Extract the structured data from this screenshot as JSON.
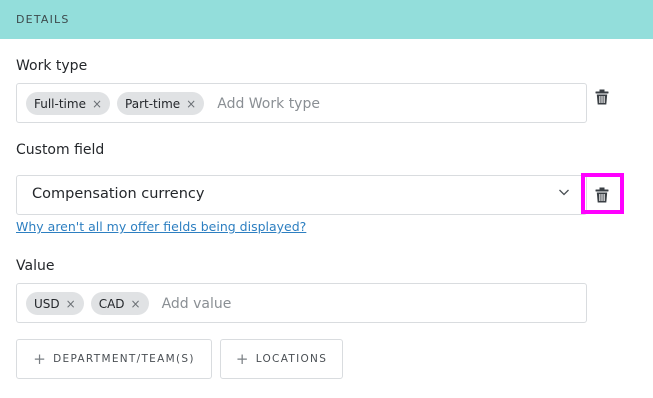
{
  "header": {
    "title": "DETAILS"
  },
  "work_type": {
    "label": "Work type",
    "tags": [
      {
        "text": "Full-time",
        "remove": "×"
      },
      {
        "text": "Part-time",
        "remove": "×"
      }
    ],
    "placeholder": "Add Work type",
    "delete_icon": "trash-icon"
  },
  "custom_field": {
    "label": "Custom field",
    "selected": "Compensation currency",
    "dropdown_icon": "chevron-down-icon",
    "delete_icon": "trash-icon",
    "highlight_color": "#ff00ff"
  },
  "help_link": {
    "text": "Why aren't all my offer fields being displayed?"
  },
  "value": {
    "label": "Value",
    "tags": [
      {
        "text": "USD",
        "remove": "×"
      },
      {
        "text": "CAD",
        "remove": "×"
      }
    ],
    "placeholder": "Add value"
  },
  "buttons": {
    "department": {
      "icon": "+",
      "label": "DEPARTMENT/TEAM(S)"
    },
    "locations": {
      "icon": "+",
      "label": "LOCATIONS"
    }
  },
  "colors": {
    "header_bg": "#93dedb",
    "link": "#2d7fc1",
    "tag_bg": "#e0e2e4"
  }
}
